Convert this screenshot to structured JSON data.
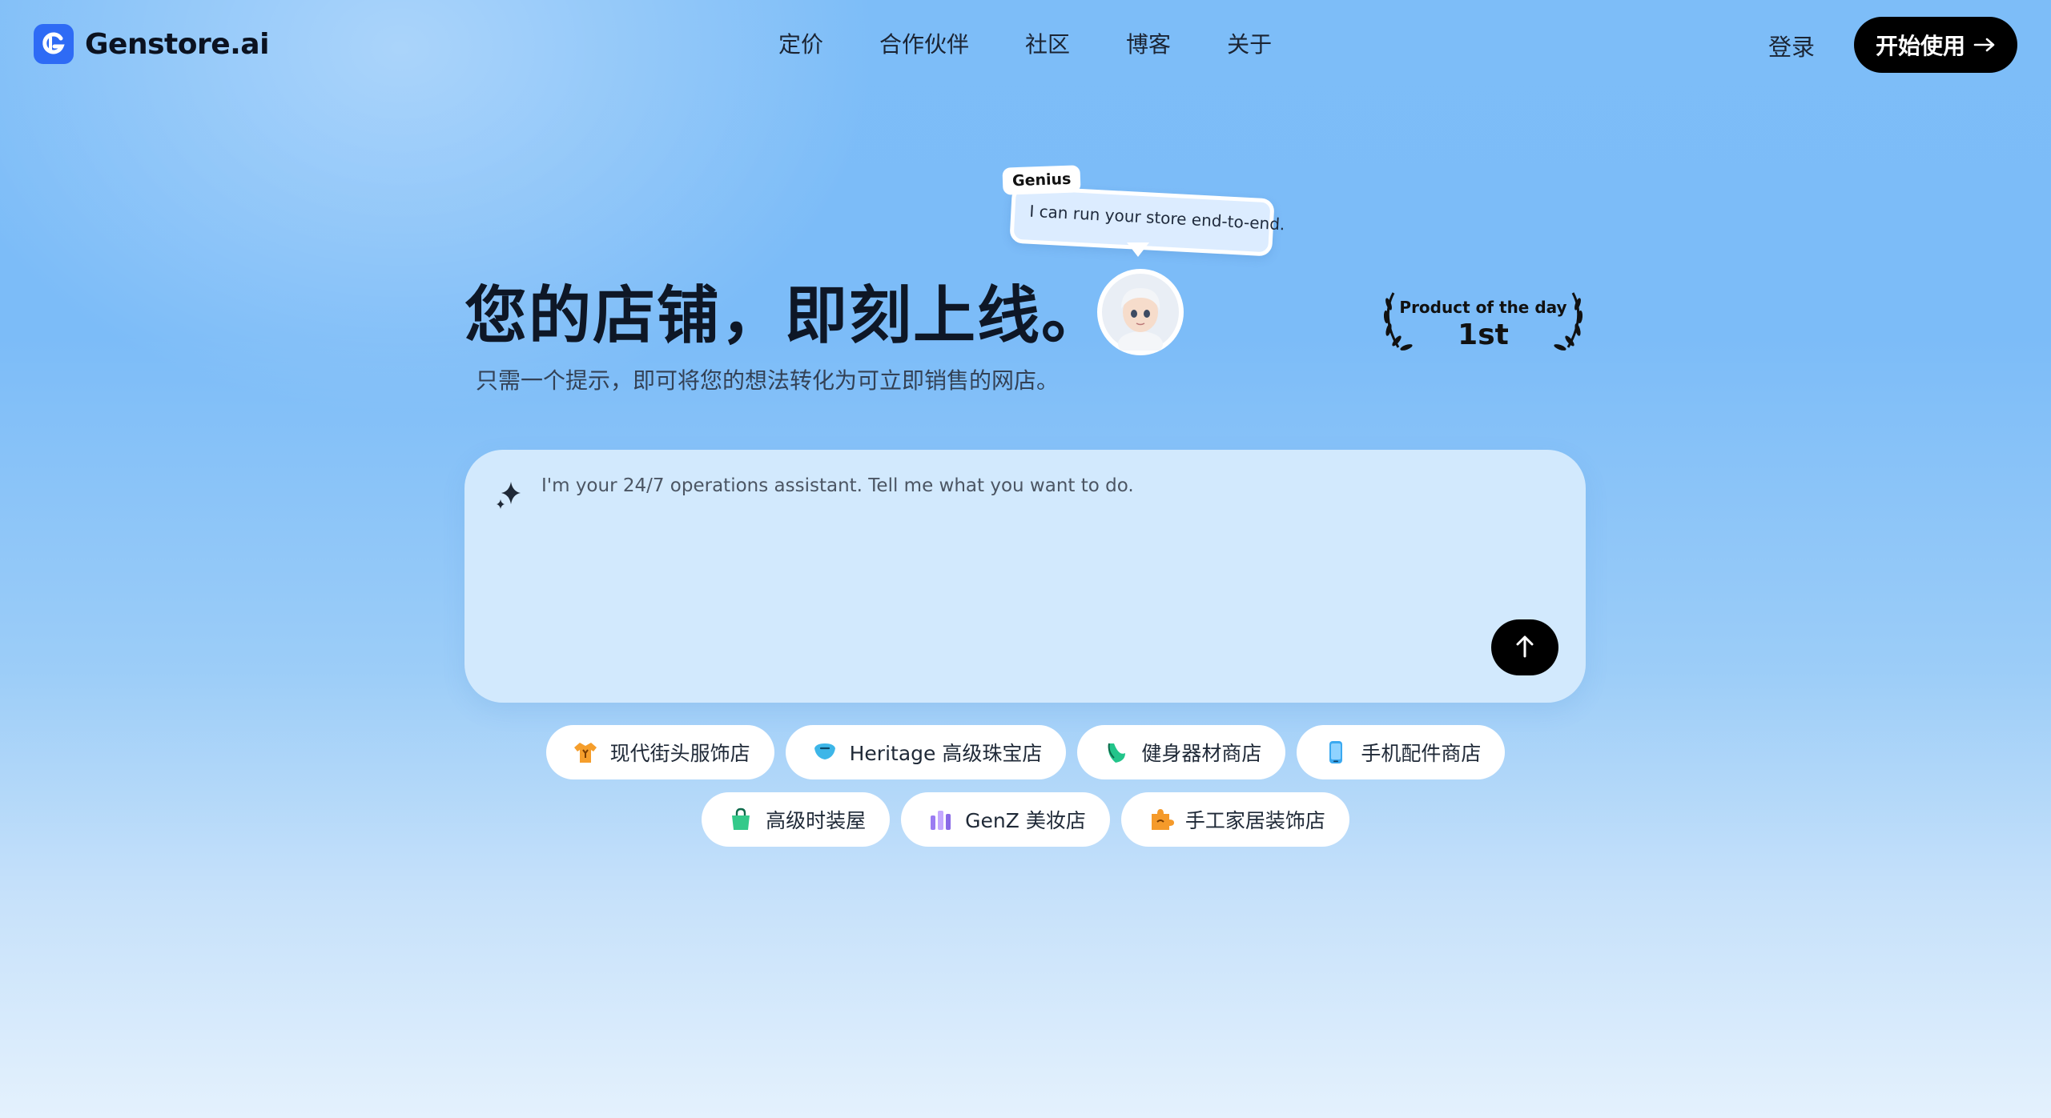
{
  "header": {
    "logo_text": "Genstore.ai",
    "nav": [
      "定价",
      "合作伙伴",
      "社区",
      "博客",
      "关于"
    ],
    "login": "登录",
    "cta": "开始使用",
    "cta_icon": "arrow-right-icon"
  },
  "hero": {
    "bubble_tag": "Genius",
    "bubble_text": "I can run your store end-to-end.",
    "title": "您的店铺，即刻上线。",
    "subtitle": "只需一个提示，即可将您的想法转化为可立即销售的网店。",
    "award_label": "Product of the day",
    "award_rank": "1st"
  },
  "prompt": {
    "placeholder": "I'm your 24/7 operations assistant. Tell me what you want to do.",
    "send_icon": "arrow-up-icon"
  },
  "chips": {
    "row1": [
      {
        "label": "现代街头服饰店",
        "icon": "shirt-icon"
      },
      {
        "label": "Heritage 高级珠宝店",
        "icon": "gem-icon"
      },
      {
        "label": "健身器材商店",
        "icon": "dumbbell-icon"
      },
      {
        "label": "手机配件商店",
        "icon": "phone-icon"
      }
    ],
    "row2": [
      {
        "label": "高级时装屋",
        "icon": "shopping-bag-icon"
      },
      {
        "label": "GenZ 美妆店",
        "icon": "cosmetics-icon"
      },
      {
        "label": "手工家居装饰店",
        "icon": "puzzle-icon"
      }
    ]
  },
  "colors": {
    "brand": "#2e6bf5",
    "cta_bg": "#000000",
    "prompt_bg": "#d2e9fd"
  }
}
